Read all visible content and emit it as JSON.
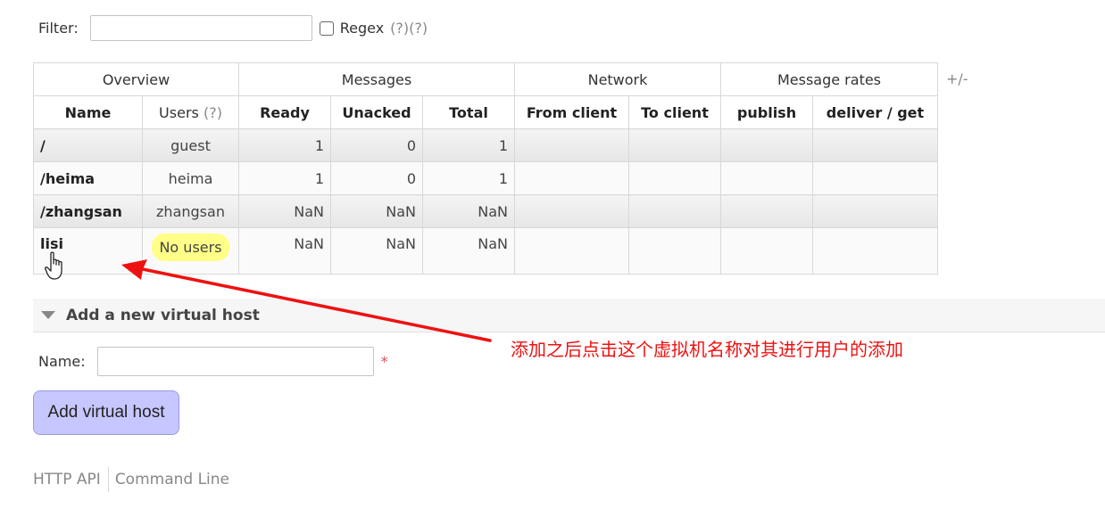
{
  "filter": {
    "label": "Filter:",
    "value": "",
    "regex_label": "Regex",
    "help1": "(?)",
    "help2": "(?)"
  },
  "table": {
    "groups": [
      "Overview",
      "Messages",
      "Network",
      "Message rates"
    ],
    "plus_minus": "+/-",
    "columns": {
      "name": "Name",
      "users": "Users",
      "users_help": "(?)",
      "ready": "Ready",
      "unacked": "Unacked",
      "total": "Total",
      "from_client": "From client",
      "to_client": "To client",
      "publish": "publish",
      "deliver_get": "deliver / get"
    },
    "rows": [
      {
        "name": "/",
        "users": "guest",
        "ready": "1",
        "unacked": "0",
        "total": "1"
      },
      {
        "name": "/heima",
        "users": "heima",
        "ready": "1",
        "unacked": "0",
        "total": "1"
      },
      {
        "name": "/zhangsan",
        "users": "zhangsan",
        "ready": "NaN",
        "unacked": "NaN",
        "total": "NaN"
      },
      {
        "name": "lisi",
        "users": "No users",
        "ready": "NaN",
        "unacked": "NaN",
        "total": "NaN"
      }
    ]
  },
  "add_section": {
    "title": "Add a new virtual host",
    "name_label": "Name:",
    "name_value": "",
    "required_mark": "*",
    "button_label": "Add virtual host"
  },
  "footer": {
    "http_api": "HTTP API",
    "command_line": "Command Line"
  },
  "annotation": {
    "text": "添加之后点击这个虚拟机名称对其进行用户的添加",
    "color": "#ee1111"
  },
  "colors": {
    "highlight_no_users": "#ffff88",
    "button_bg": "#c7c7ff",
    "required": "#e05050"
  }
}
